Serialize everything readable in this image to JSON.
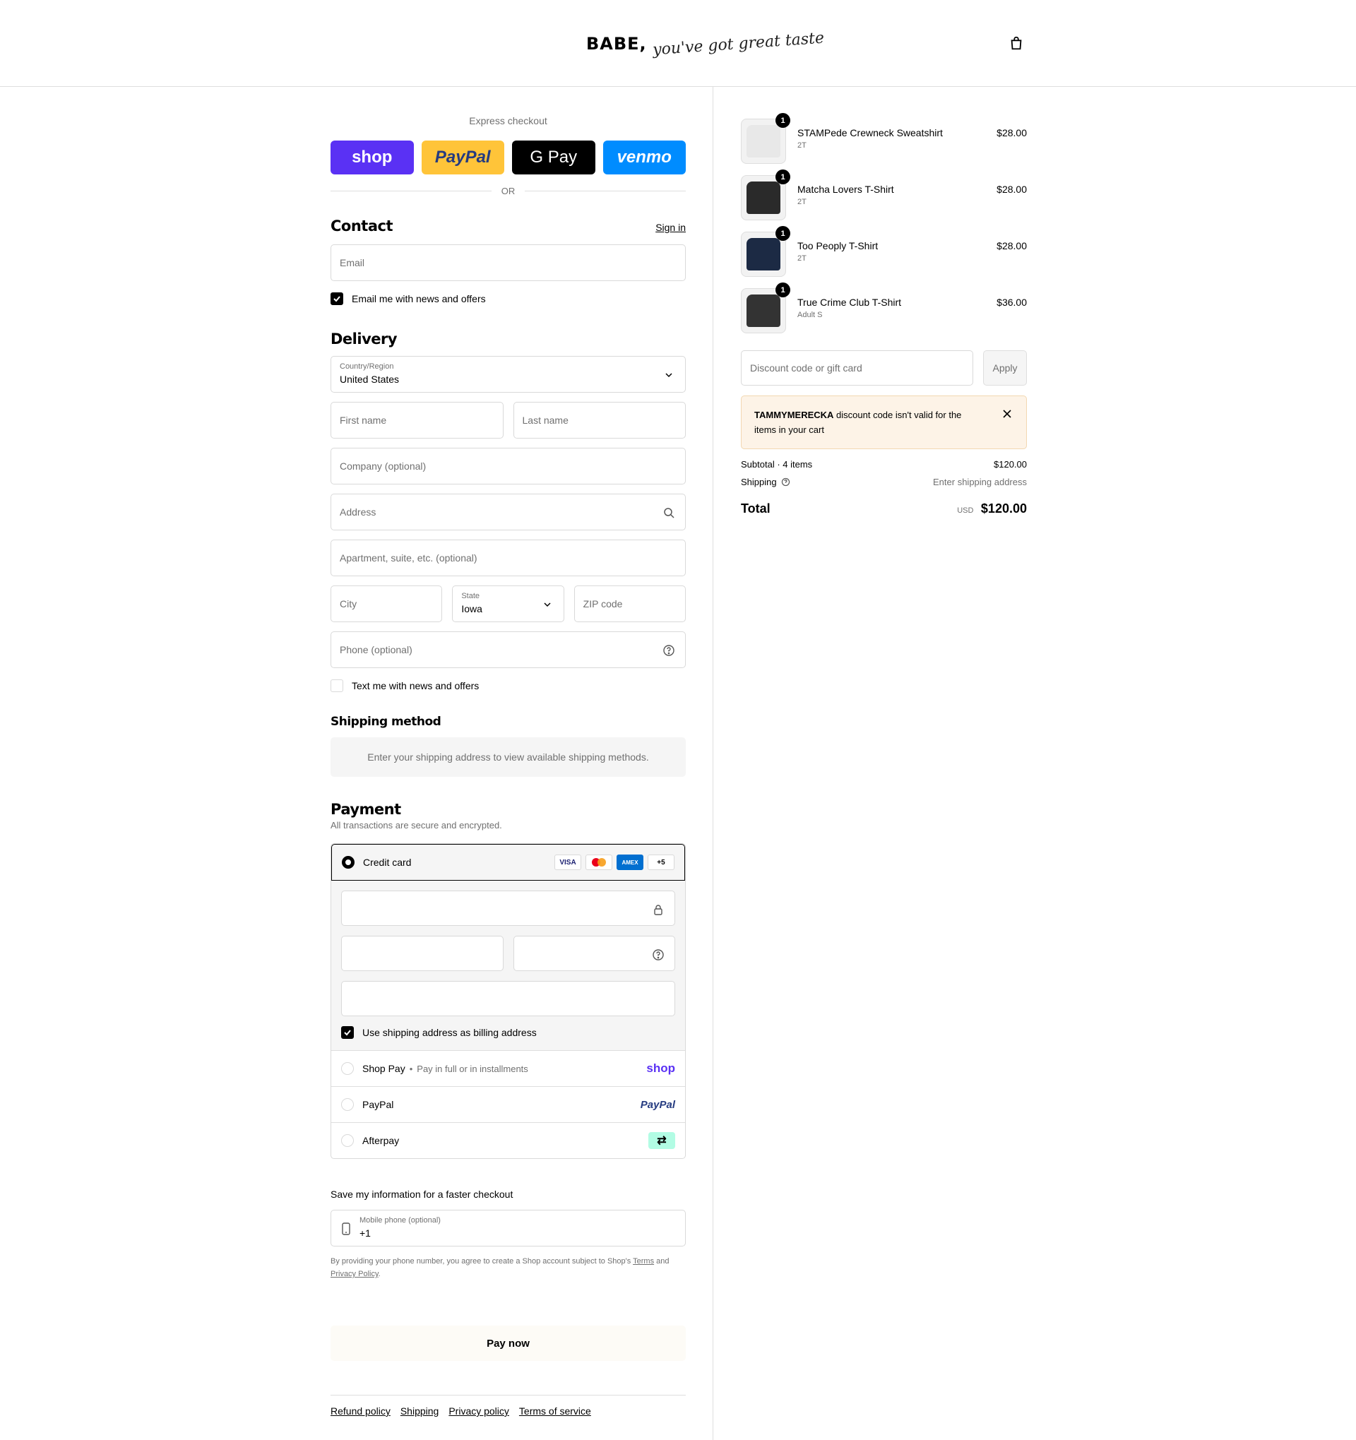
{
  "header": {
    "logo_main": "BABE,",
    "logo_script": "you've got great taste"
  },
  "express": {
    "title": "Express checkout",
    "or": "OR",
    "buttons": [
      {
        "label": "shop",
        "bg": "#5a31f4",
        "fg": "#ffffff"
      },
      {
        "label": "PayPal",
        "bg": "#ffc439",
        "fg": "#253b80"
      },
      {
        "label": "G Pay",
        "bg": "#000000",
        "fg": "#ffffff"
      },
      {
        "label": "venmo",
        "bg": "#008cff",
        "fg": "#ffffff"
      }
    ]
  },
  "contact": {
    "title": "Contact",
    "signin": "Sign in",
    "email_placeholder": "Email",
    "news": "Email me with news and offers"
  },
  "delivery": {
    "title": "Delivery",
    "country_label": "Country/Region",
    "country": "United States",
    "first_name": "First name",
    "last_name": "Last name",
    "company": "Company (optional)",
    "address": "Address",
    "apartment": "Apartment, suite, etc. (optional)",
    "city": "City",
    "state_label": "State",
    "state": "Iowa",
    "zip": "ZIP code",
    "phone": "Phone (optional)",
    "text_news": "Text me with news and offers"
  },
  "shipping_method": {
    "title": "Shipping method",
    "message": "Enter your shipping address to view available shipping methods."
  },
  "payment": {
    "title": "Payment",
    "subtitle": "All transactions are secure and encrypted.",
    "credit_card": "Credit card",
    "cards": [
      "VISA",
      "MC",
      "AMEX",
      "+5"
    ],
    "billing_same": "Use shipping address as billing address",
    "shop_pay": "Shop Pay",
    "shop_pay_sub": "Pay in full or in installments",
    "shop_pay_logo": "shop",
    "paypal": "PayPal",
    "paypal_logo": "PayPal",
    "afterpay": "Afterpay",
    "afterpay_logo": "⇄"
  },
  "save": {
    "title": "Save my information for a faster checkout",
    "mobile_label": "Mobile phone (optional)",
    "mobile_value": "+1",
    "legal_pre": "By providing your phone number, you agree to create a Shop account subject to Shop's",
    "terms": "Terms",
    "and": "and",
    "privacy": "Privacy Policy",
    "dot": "."
  },
  "pay_now": "Pay now",
  "footer": [
    "Refund policy",
    "Shipping",
    "Privacy policy",
    "Terms of service"
  ],
  "cart": {
    "items": [
      {
        "name": "STAMPede Crewneck Sweatshirt",
        "variant": "2T",
        "price": "$28.00",
        "qty": "1",
        "color": "#e8e8e8"
      },
      {
        "name": "Matcha Lovers T-Shirt",
        "variant": "2T",
        "price": "$28.00",
        "qty": "1",
        "color": "#2a2a2a"
      },
      {
        "name": "Too Peoply T-Shirt",
        "variant": "2T",
        "price": "$28.00",
        "qty": "1",
        "color": "#1c2a44"
      },
      {
        "name": "True Crime Club T-Shirt",
        "variant": "Adult S",
        "price": "$36.00",
        "qty": "1",
        "color": "#333333"
      }
    ],
    "discount_placeholder": "Discount code or gift card",
    "apply": "Apply",
    "alert_code": "TAMMYMERECKA",
    "alert_text": "discount code isn't valid for the items in your cart",
    "subtotal_label": "Subtotal · 4 items",
    "subtotal": "$120.00",
    "shipping_label": "Shipping",
    "shipping_value": "Enter shipping address",
    "total_label": "Total",
    "currency": "USD",
    "total": "$120.00"
  }
}
